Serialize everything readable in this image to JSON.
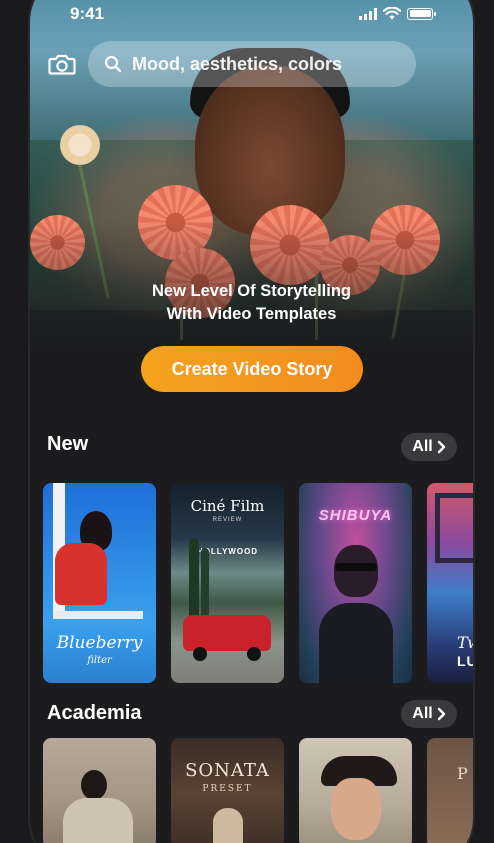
{
  "status_bar": {
    "time": "9:41"
  },
  "search": {
    "placeholder": "Mood, aesthetics, colors"
  },
  "hero": {
    "headline_line1": "New Level Of Storytelling",
    "headline_line2": "With Video Templates",
    "cta_label": "Create Video Story"
  },
  "sections": {
    "new": {
      "title": "New",
      "all_label": "All",
      "cards": [
        {
          "title": "Blueberry",
          "subtitle": "filter"
        },
        {
          "title": "Ciné Film",
          "subtitle": "REVIEW",
          "sign": "HOLLYWOOD"
        },
        {
          "title": "SHIBUYA"
        },
        {
          "title": "Twin",
          "subtitle": "LUS"
        }
      ]
    },
    "academia": {
      "title": "Academia",
      "all_label": "All",
      "cards": [
        {
          "title": ""
        },
        {
          "title": "SONATA",
          "subtitle": "PRESET"
        },
        {
          "title": ""
        },
        {
          "title": "P"
        }
      ]
    }
  },
  "colors": {
    "accent": "#F59A1E",
    "background": "#1C1C1E",
    "pill": "#3A3A3C"
  }
}
